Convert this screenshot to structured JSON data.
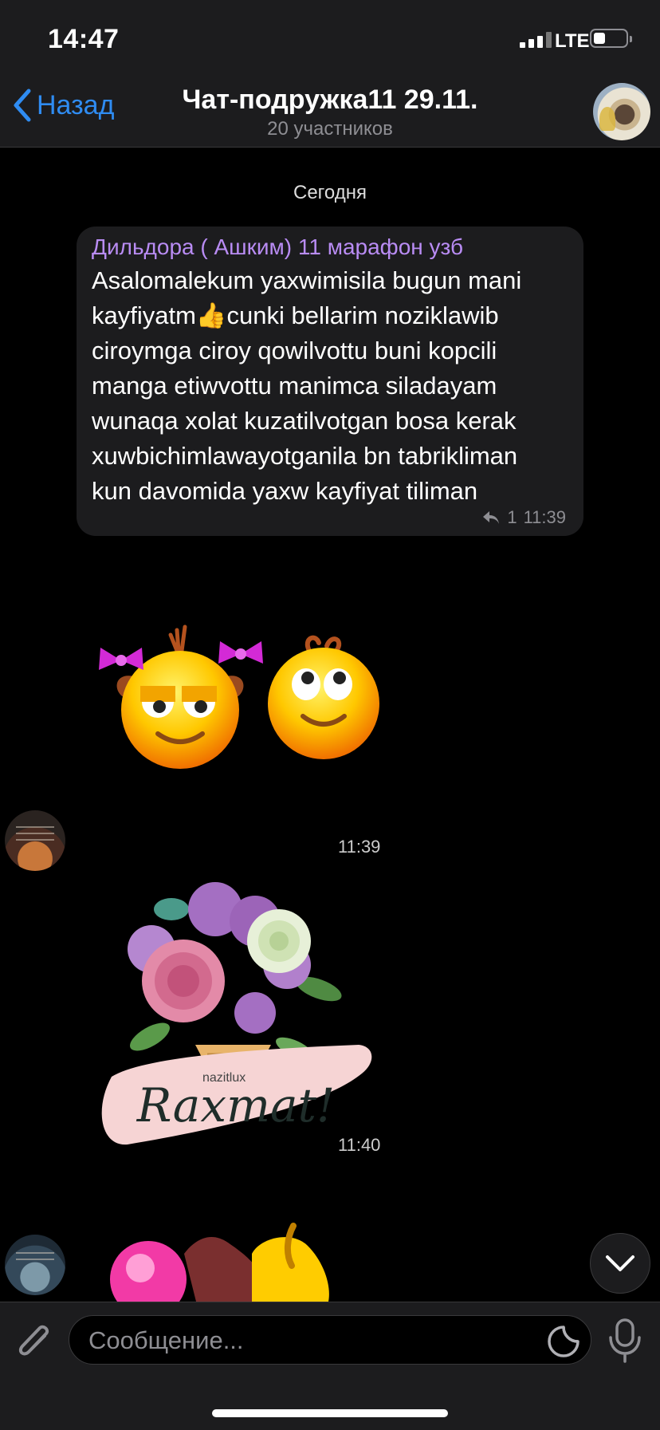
{
  "status_bar": {
    "time": "14:47",
    "network": "LTE"
  },
  "nav": {
    "back_label": "Назад",
    "title": "Чат-подружка11 29.11.",
    "subtitle": "20 участников"
  },
  "date_divider": "Сегодня",
  "message": {
    "sender": "Дильдора ( Ашким) 11 марафон узб",
    "lines": [
      "Asalomalekum yaxwimisila bugun mani",
      "kayfiyatm👍cunki bellarim noziklawib",
      "ciroymga ciroy qowilvottu buni kopcili",
      "manga etiwvottu manimca siladayam",
      "wunaqa xolat kuzatilvotgan bosa kerak",
      "xuwbichimlawayotganila bn tabrikliman",
      "kun davomida yaxw kayfiyat tiliman"
    ],
    "reply_count": "1",
    "time": "11:39"
  },
  "stickers": [
    {
      "name": "two-smiley-faces",
      "time": "11:39"
    },
    {
      "name": "flower-bouquet",
      "text": "Raxmat!",
      "brand": "nazitlux",
      "time": "11:40"
    }
  ],
  "input": {
    "placeholder": "Сообщение..."
  },
  "colors": {
    "accent": "#2f8cf2",
    "sender_name": "#b98cf4",
    "bar_background": "#1c1c1e"
  }
}
